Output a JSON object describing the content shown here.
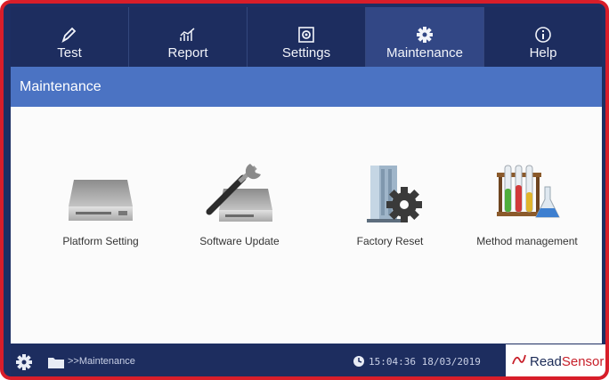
{
  "nav": {
    "tabs": [
      {
        "label": "Test",
        "icon": "pen-icon"
      },
      {
        "label": "Report",
        "icon": "chart-icon"
      },
      {
        "label": "Settings",
        "icon": "settings-box-icon"
      },
      {
        "label": "Maintenance",
        "icon": "gear-icon",
        "active": true
      },
      {
        "label": "Help",
        "icon": "info-icon"
      }
    ]
  },
  "header": {
    "title": "Maintenance"
  },
  "main": {
    "items": [
      {
        "label": "Platform Setting",
        "icon": "device-icon"
      },
      {
        "label": "Software Update",
        "icon": "wrench-device-icon"
      },
      {
        "label": "Factory Reset",
        "icon": "building-gear-icon"
      },
      {
        "label": "Method management",
        "icon": "test-tubes-icon"
      }
    ]
  },
  "status": {
    "path": ">>Maintenance",
    "time": "15:04:36 18/03/2019"
  },
  "brand": {
    "part1": "Read",
    "part2": "Sensor"
  },
  "colors": {
    "nav_bg": "#1d2d5f",
    "active_tab": "#324785",
    "header_bg": "#4b73c3",
    "frame": "#d81e2a",
    "brand_red": "#c8202a"
  }
}
